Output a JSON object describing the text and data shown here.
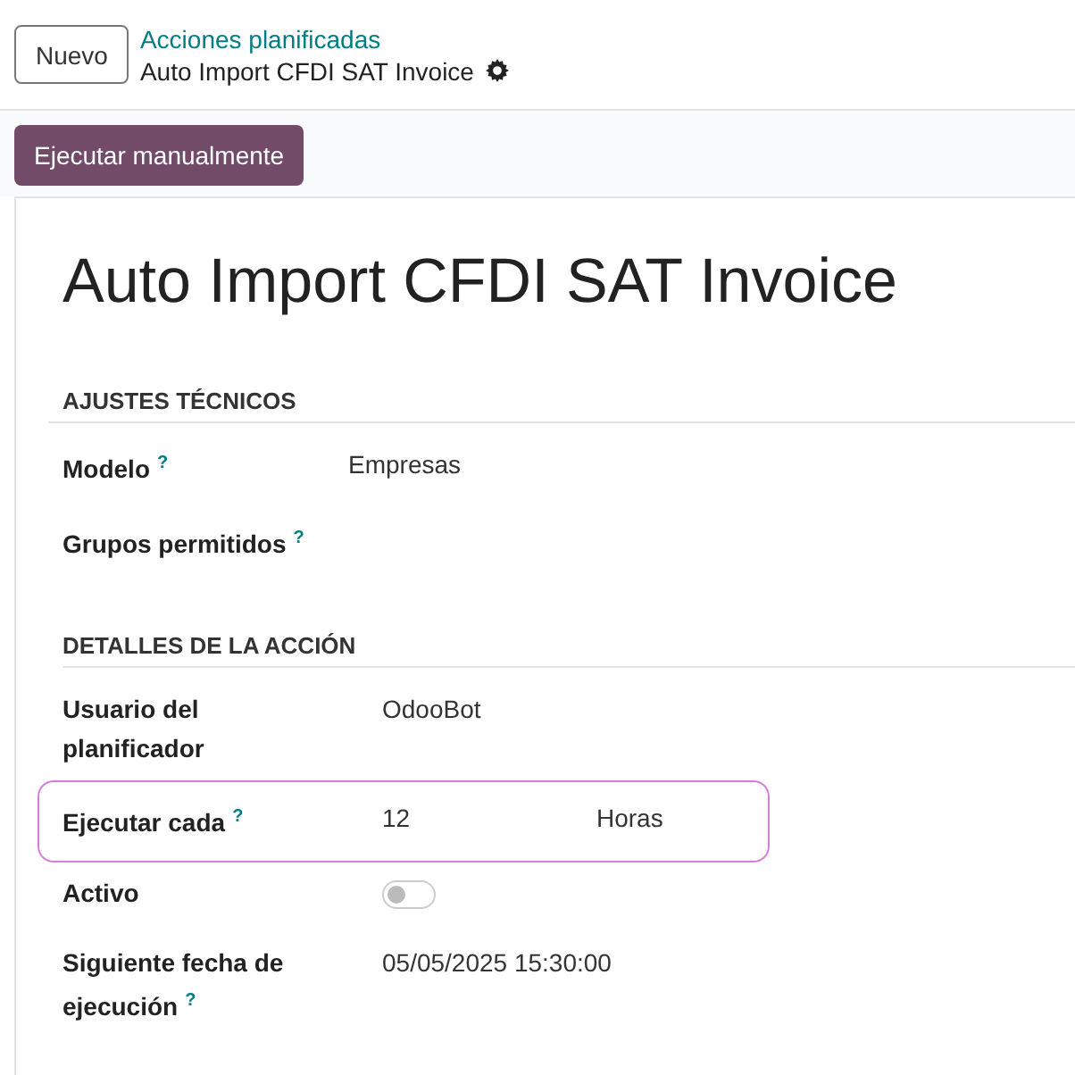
{
  "control_panel": {
    "new_button": "Nuevo",
    "breadcrumb": {
      "parent": "Acciones planificadas",
      "current": "Auto Import CFDI SAT Invoice"
    }
  },
  "action_button": "Ejecutar manualmente",
  "record": {
    "title": "Auto Import CFDI SAT Invoice",
    "sections": [
      {
        "title": "AJUSTES TÉCNICOS",
        "fields": [
          {
            "kind": "text",
            "label": "Modelo",
            "help": "?",
            "value": "Empresas",
            "highlighted": false
          },
          {
            "kind": "text",
            "label": "Grupos permitidos",
            "help": "?",
            "highlighted": false
          }
        ]
      },
      {
        "title": "DETALLES DE LA ACCIÓN",
        "fields": [
          {
            "kind": "text",
            "label": "Usuario del planificador",
            "value": "OdooBot",
            "highlighted": false
          },
          {
            "kind": "interval",
            "label": "Ejecutar cada",
            "help": "?",
            "value": "12",
            "unit": "Horas",
            "highlighted": true
          },
          {
            "kind": "toggle",
            "label": "Activo",
            "on": false,
            "highlighted": false
          },
          {
            "kind": "text",
            "label": "Siguiente fecha de ejecución",
            "help": "?",
            "value": "05/05/2025 15:30:00",
            "highlighted": false
          }
        ]
      }
    ]
  }
}
